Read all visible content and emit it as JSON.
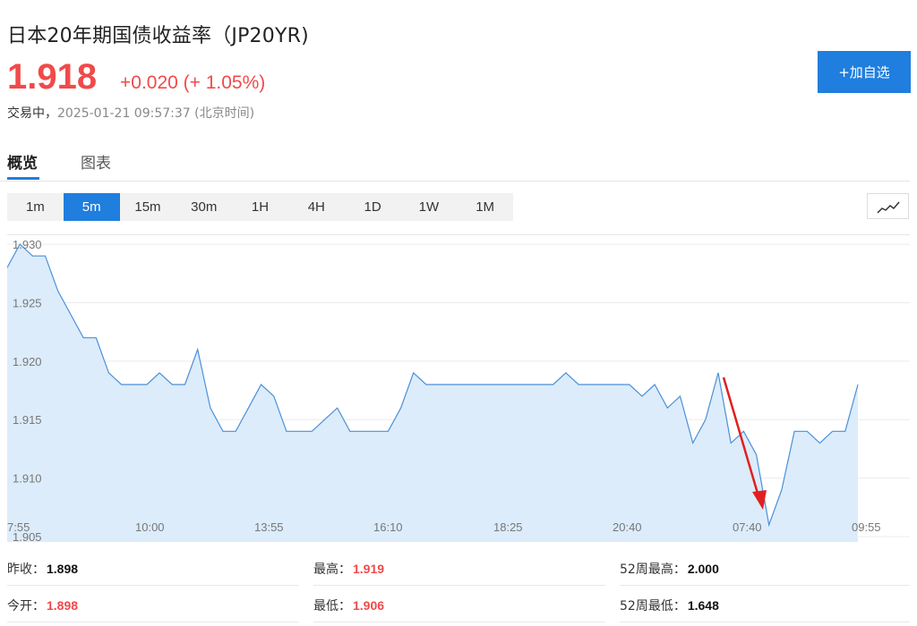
{
  "header": {
    "title": "日本20年期国债收益率（JP20YR)",
    "price": "1.918",
    "change": "+0.020 (+ 1.05%)",
    "status_label": "交易中，",
    "timestamp": "2025-01-21 09:57:37 (北京时间)",
    "add_watchlist": "+加自选"
  },
  "tabs": [
    {
      "label": "概览",
      "active": true
    },
    {
      "label": "图表",
      "active": false
    }
  ],
  "intervals": {
    "items": [
      "1m",
      "5m",
      "15m",
      "30m",
      "1H",
      "4H",
      "1D",
      "1W",
      "1M"
    ],
    "active": "5m"
  },
  "chart_type_icon": "line-chart-icon",
  "colors": {
    "accent": "#1f7ede",
    "up": "#f04a4a",
    "line": "#4a90d9",
    "fill": "#dcecfb"
  },
  "chart_data": {
    "type": "area",
    "yticks": [
      "1.930",
      "1.925",
      "1.920",
      "1.915",
      "1.910",
      "1.905"
    ],
    "ylim": [
      1.905,
      1.931
    ],
    "xticks": [
      "7:55",
      "10:00",
      "13:55",
      "16:10",
      "18:25",
      "20:40",
      "07:40",
      "09:55"
    ],
    "values": [
      1.928,
      1.93,
      1.929,
      1.929,
      1.926,
      1.924,
      1.922,
      1.922,
      1.919,
      1.918,
      1.918,
      1.918,
      1.919,
      1.918,
      1.918,
      1.921,
      1.916,
      1.914,
      1.914,
      1.916,
      1.918,
      1.917,
      1.914,
      1.914,
      1.914,
      1.915,
      1.916,
      1.914,
      1.914,
      1.914,
      1.914,
      1.916,
      1.919,
      1.918,
      1.918,
      1.918,
      1.918,
      1.918,
      1.918,
      1.918,
      1.918,
      1.918,
      1.918,
      1.918,
      1.919,
      1.918,
      1.918,
      1.918,
      1.918,
      1.918,
      1.917,
      1.918,
      1.916,
      1.917,
      1.913,
      1.915,
      1.919,
      1.913,
      1.914,
      1.912,
      1.906,
      1.909,
      1.914,
      1.914,
      1.913,
      1.914,
      1.914,
      1.918
    ],
    "grid": true
  },
  "stats": {
    "prev_close_label": "昨收：",
    "prev_close": "1.898",
    "high_label": "最高：",
    "high": "1.919",
    "w52_high_label": "52周最高：",
    "w52_high": "2.000",
    "open_label": "今开：",
    "open": "1.898",
    "low_label": "最低：",
    "low": "1.906",
    "w52_low_label": "52周最低：",
    "w52_low": "1.648"
  }
}
